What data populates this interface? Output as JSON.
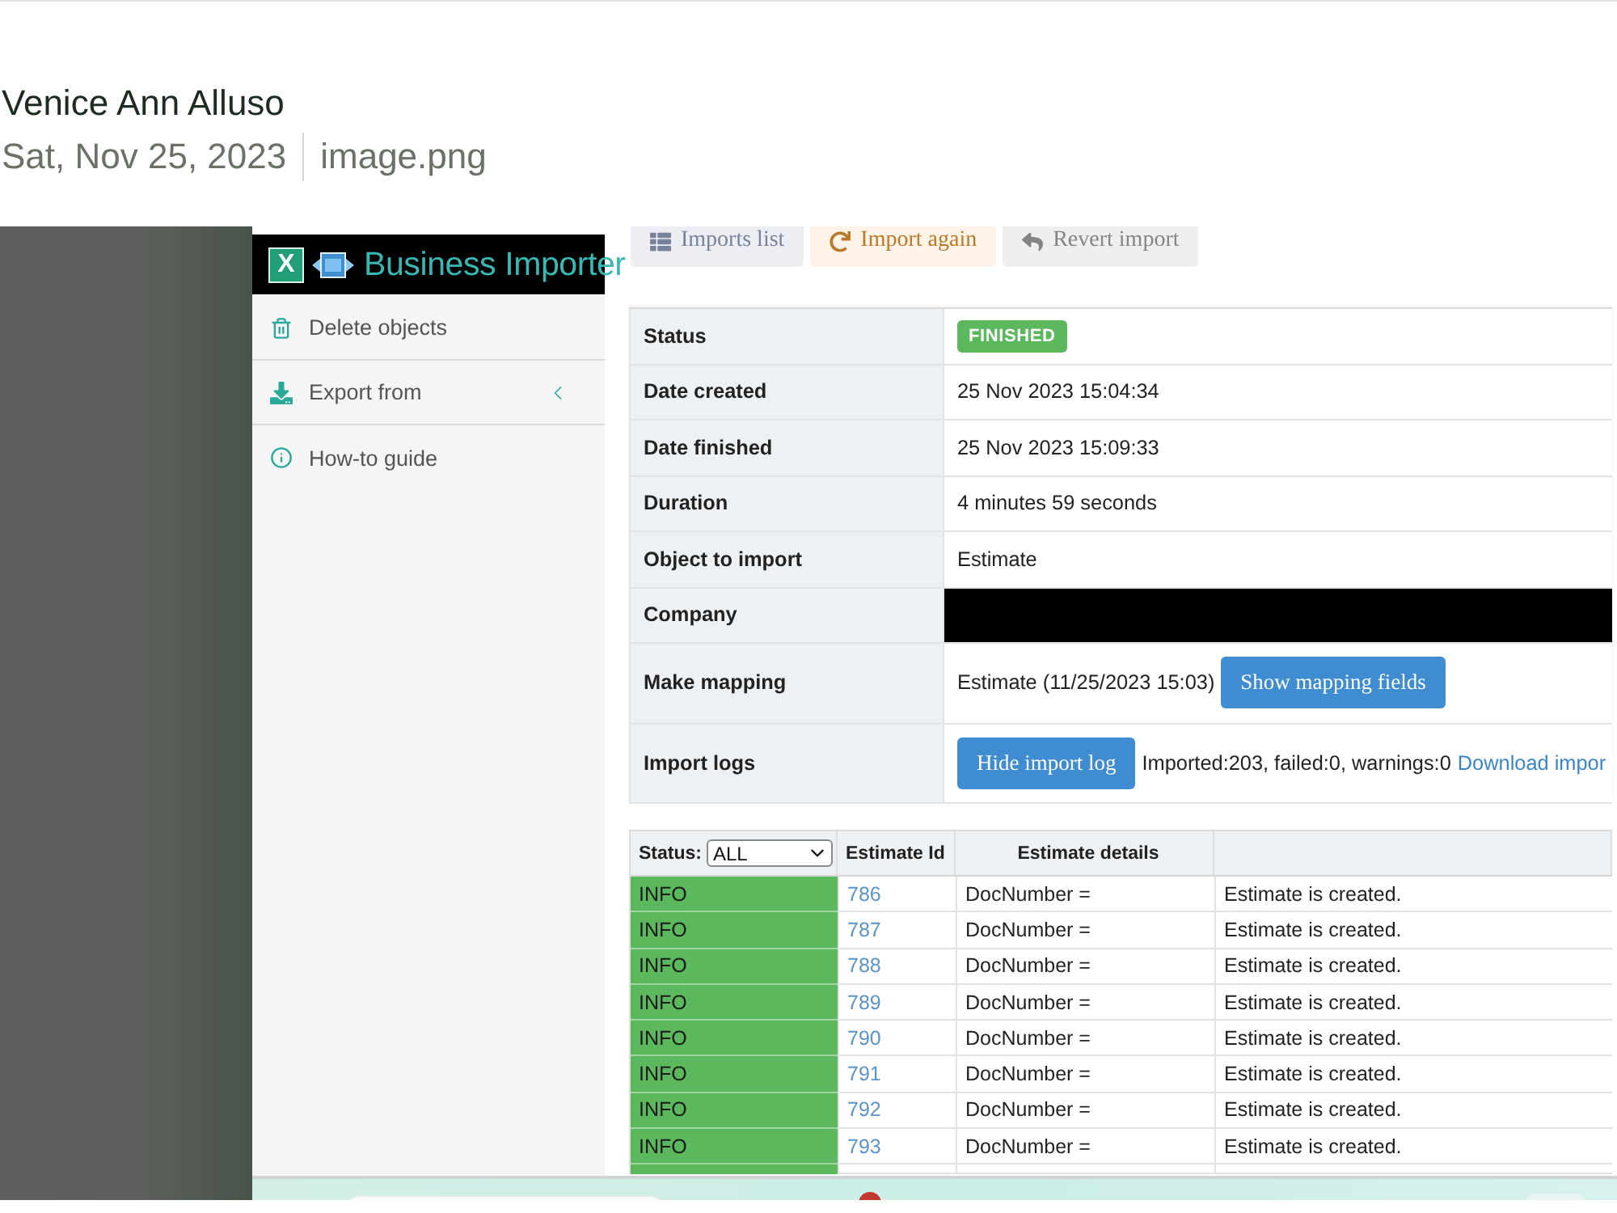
{
  "message": {
    "sender": "Venice Ann Alluso",
    "date": "Sat, Nov 25, 2023",
    "attachment": "image.png"
  },
  "app": {
    "logo": {
      "mark": "X",
      "name": "Business Importer"
    },
    "toolbar": [
      {
        "kind": "list",
        "label": "Imports list",
        "disabled": true
      },
      {
        "kind": "repeat",
        "label": "Import again",
        "disabled": true
      },
      {
        "kind": "revert",
        "label": "Revert import",
        "disabled": true
      }
    ],
    "sidebar": [
      {
        "kind": "delete",
        "label": "Delete objects",
        "submenu": false
      },
      {
        "kind": "export",
        "label": "Export from",
        "submenu": true
      },
      {
        "kind": "help",
        "label": "How-to guide",
        "submenu": false
      }
    ],
    "details": [
      {
        "kind": "badge",
        "label": "Status",
        "value": "FINISHED"
      },
      {
        "kind": "text",
        "label": "Date created",
        "value": "25 Nov 2023 15:04:34"
      },
      {
        "kind": "text",
        "label": "Date finished",
        "value": "25 Nov 2023 15:09:33"
      },
      {
        "kind": "text",
        "label": "Duration",
        "value": "4 minutes 59 seconds"
      },
      {
        "kind": "text",
        "label": "Object to import",
        "value": "Estimate"
      },
      {
        "kind": "redacted",
        "label": "Company"
      },
      {
        "kind": "mapping",
        "label": "Make mapping",
        "value": "Estimate (11/25/2023 15:03)",
        "button": "Show mapping fields"
      },
      {
        "kind": "logs",
        "label": "Import logs",
        "button": "Hide import log",
        "value": "Imported:203, failed:0, warnings:0",
        "link": "Download impor"
      }
    ],
    "log_table": {
      "status_label": "Status:",
      "status_filter": "ALL",
      "columns": [
        "Estimate Id",
        "Estimate details"
      ],
      "rows": [
        {
          "status": "INFO",
          "estimate_id": "786",
          "details": "DocNumber =",
          "message": "Estimate is created."
        },
        {
          "status": "INFO",
          "estimate_id": "787",
          "details": "DocNumber =",
          "message": "Estimate is created."
        },
        {
          "status": "INFO",
          "estimate_id": "788",
          "details": "DocNumber =",
          "message": "Estimate is created."
        },
        {
          "status": "INFO",
          "estimate_id": "789",
          "details": "DocNumber =",
          "message": "Estimate is created."
        },
        {
          "status": "INFO",
          "estimate_id": "790",
          "details": "DocNumber =",
          "message": "Estimate is created."
        },
        {
          "status": "INFO",
          "estimate_id": "791",
          "details": "DocNumber =",
          "message": "Estimate is created."
        },
        {
          "status": "INFO",
          "estimate_id": "792",
          "details": "DocNumber =",
          "message": "Estimate is created."
        },
        {
          "status": "INFO",
          "estimate_id": "793",
          "details": "DocNumber =",
          "message": "Estimate is created."
        }
      ]
    }
  }
}
